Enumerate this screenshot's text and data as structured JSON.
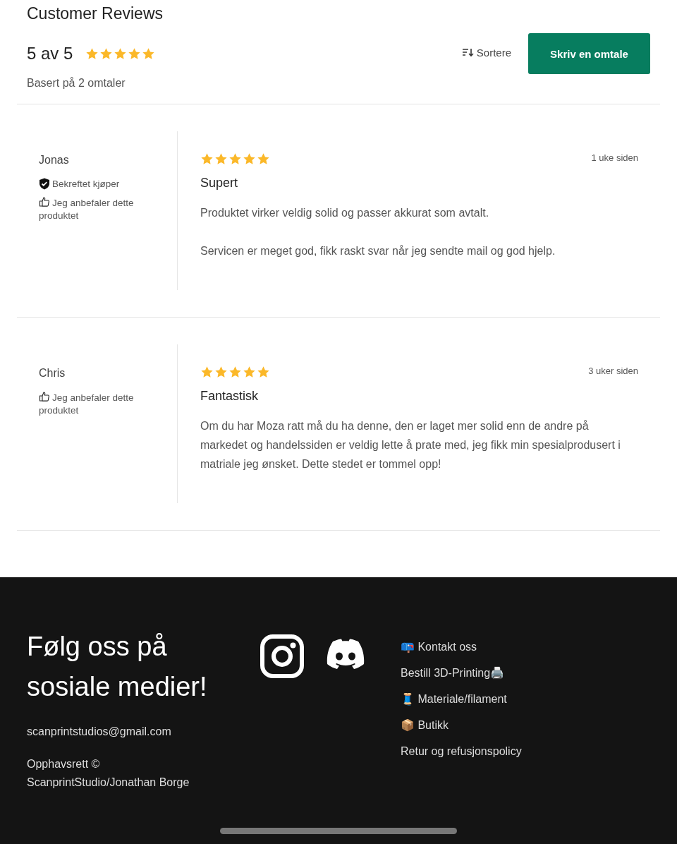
{
  "title": "Customer Reviews",
  "summary": {
    "score": "5 av 5",
    "stars": 5,
    "based_on": "Basert på 2 omtaler",
    "sort_label": "Sortere",
    "write_button": "Skriv en omtale"
  },
  "reviews": [
    {
      "author": "Jonas",
      "verified": true,
      "verified_label": "Bekreftet kjøper",
      "recommends": true,
      "recommend_label": "Jeg anbefaler dette produktet",
      "stars": 5,
      "date": "1 uke siden",
      "heading": "Supert",
      "paragraphs": [
        "Produktet virker veldig solid og passer akkurat som avtalt.",
        "Servicen er meget god, fikk raskt svar når jeg sendte mail og god hjelp."
      ]
    },
    {
      "author": "Chris",
      "verified": false,
      "recommends": true,
      "recommend_label": "Jeg anbefaler dette produktet",
      "stars": 5,
      "date": "3 uker siden",
      "heading": "Fantastisk",
      "paragraphs": [
        "Om du har Moza ratt må du ha denne, den er laget mer solid enn de andre på markedet og handelssiden er veldig lette å prate med, jeg fikk min spesialprodusert i matriale jeg ønsket. Dette stedet er tommel opp!"
      ]
    }
  ],
  "footer": {
    "heading": "Følg oss på sosiale medier!",
    "email": "scanprintstudios@gmail.com",
    "copyright": "Opphavsrett © ScanprintStudio/Jonathan Borge",
    "links": [
      "📪 Kontakt oss",
      "Bestill 3D-Printing🖨️",
      "🧵 Materiale/filament",
      "📦 Butikk",
      "Retur og refusjonspolicy"
    ]
  }
}
